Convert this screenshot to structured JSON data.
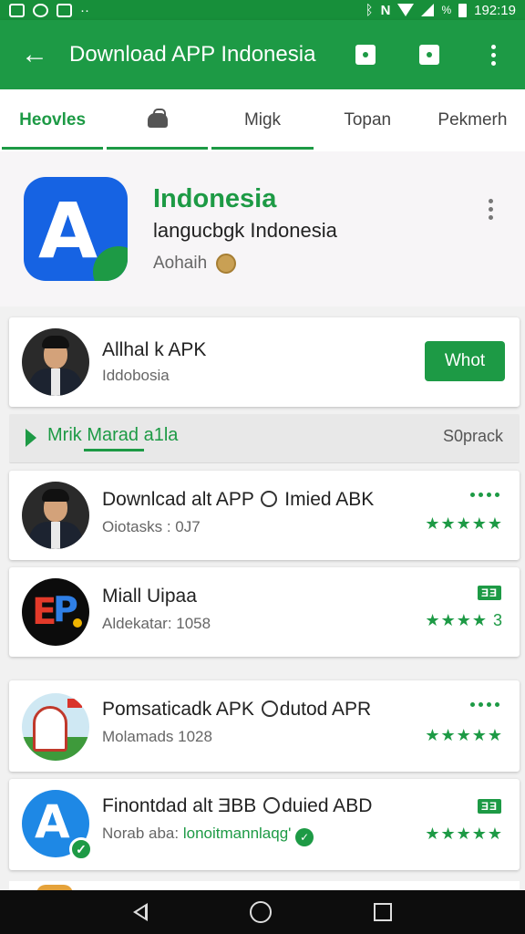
{
  "status_bar": {
    "time": "192:19",
    "battery_label": "%"
  },
  "app_bar": {
    "title": "Download APP Indonesia"
  },
  "tabs": [
    {
      "label": "Heovles",
      "active": true
    },
    {
      "label": "",
      "icon": "bag-icon"
    },
    {
      "label": "Migk"
    },
    {
      "label": "Topan"
    },
    {
      "label": "Pekmerh"
    }
  ],
  "header_app": {
    "name": "Indonesia",
    "subtitle": "langucbgk Indonesia",
    "developer": "Aohaih"
  },
  "featured": {
    "title": "Allhal k APK",
    "meta": "Iddobosia",
    "button": "Whot"
  },
  "section": {
    "title": "Mrik Marad a1la",
    "more": "S0prack"
  },
  "apps": [
    {
      "title_a": "Downlcad alt APP",
      "title_b": "Imied ABK",
      "meta": "Oiotasks : 0J7",
      "stars": "★★★★★",
      "extra": "dots"
    },
    {
      "title_a": "Miall Uipaa",
      "title_b": "",
      "meta": "Aldekatar: 1058",
      "stars": "★★★★ 3",
      "extra": "badge",
      "badge": "ƎƎ"
    },
    {
      "title_a": "Pomsaticadk APK",
      "title_b": "dutod APR",
      "meta": "Molamads 1028",
      "stars": "★★★★★",
      "extra": "dots"
    },
    {
      "title_a": "Finontdad alt ƎBB",
      "title_b": "duied ABD",
      "meta": "Norab aba:",
      "meta_highlight": "lonoitmannlaqg'",
      "stars": "★★★★★",
      "extra": "badge",
      "badge": "ƎƎ"
    }
  ],
  "colors": {
    "primary": "#1d9a45",
    "status_bar": "#178f3a",
    "hero_icon": "#1663e3"
  }
}
